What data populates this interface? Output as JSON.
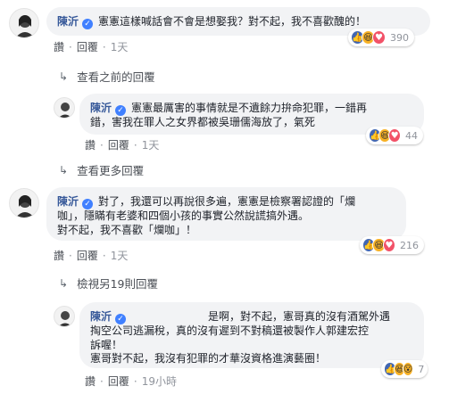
{
  "comments": [
    {
      "author": "陳沂",
      "text_lines": [
        "憲憲這樣喊話會不會是想娶我？對不起，我不喜歡醜的！"
      ],
      "reaction_count": "390",
      "actions": {
        "like": "讚",
        "reply": "回覆",
        "time": "1天"
      }
    },
    {
      "author": "陳沂",
      "text_lines": [
        "憲憲最厲害的事情就是不遺餘力拚命犯罪，一錯再",
        "錯，害我在罪人之女界都被吳珊儒海放了，氣死"
      ],
      "reaction_count": "44",
      "actions": {
        "like": "讚",
        "reply": "回覆",
        "time": "1天"
      }
    },
    {
      "author": "陳沂",
      "text_lines": [
        "對了，我還可以再說很多遍，憲憲是檢察署認證的「爛",
        "咖」，隱瞞有老婆和四個小孩的事實公然說謊搞外遇。",
        "對不起，我不喜歡「爛咖」！"
      ],
      "reaction_count": "216",
      "actions": {
        "like": "讚",
        "reply": "回覆",
        "time": "1天"
      }
    },
    {
      "author": "陳沂",
      "text_lines": [
        "是啊，對不起，憲哥真的沒有酒駕外遇",
        "掏空公司逃漏稅，真的沒有遲到不對稿還被製作人郭建宏控",
        "訴喔！",
        "憲哥對不起，我沒有犯罪的才華沒資格進演藝圈！"
      ],
      "reaction_count": "7",
      "actions": {
        "like": "讚",
        "reply": "回覆",
        "time": "19小時"
      }
    }
  ],
  "links": {
    "view_previous": "查看之前的回覆",
    "view_more": "查看更多回覆",
    "view_other": "檢視另19則回覆"
  },
  "icons": {
    "reply_arrow": "reply-arrow-icon",
    "verified": "verified-badge-icon"
  },
  "colors": {
    "author": "#365899",
    "bubble": "#f2f3f5",
    "meta": "#90949c"
  }
}
